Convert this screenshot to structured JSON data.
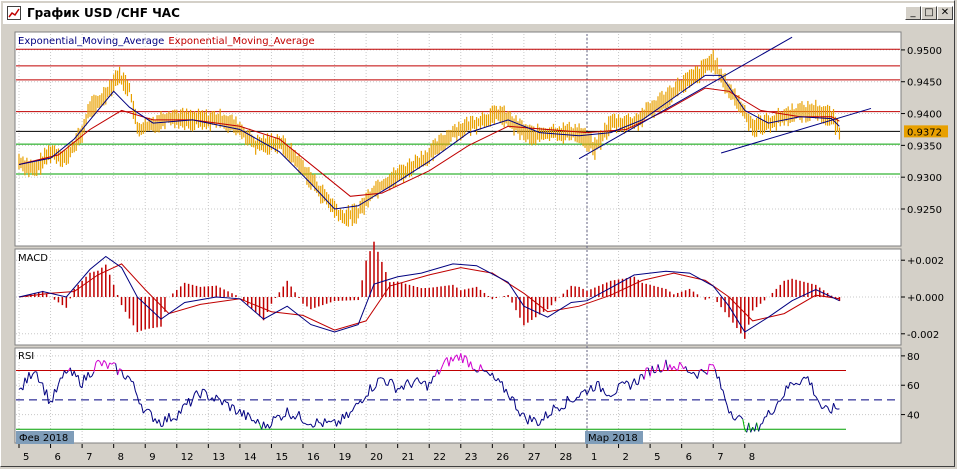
{
  "window": {
    "title": "График USD /CHF  ЧАС",
    "buttons": [
      {
        "name": "minimize",
        "glyph": "_"
      },
      {
        "name": "maximize",
        "glyph": "□"
      },
      {
        "name": "close",
        "glyph": "✕"
      }
    ]
  },
  "chart_data": [
    {
      "type": "line",
      "title": "Exponential_Moving_Average Exponential_Moving_Average",
      "series_labels": [
        "Exponential_Moving_Average",
        "Exponential_Moving_Average"
      ],
      "series_colors": {
        "price": "#e8a000",
        "ema_fast": "#000080",
        "ema_slow": "#c00000"
      },
      "ylim": [
        0.9195,
        0.9525
      ],
      "yticks": [
        "0.9500",
        "0.9450",
        "0.9400",
        "0.9350",
        "0.9300",
        "0.9250"
      ],
      "yticks_values": [
        0.95,
        0.945,
        0.94,
        0.935,
        0.93,
        0.925
      ],
      "current_price": "0.9372",
      "horizontal_levels": [
        {
          "value": 0.9501,
          "color": "#c00000"
        },
        {
          "value": 0.9475,
          "color": "#c00000"
        },
        {
          "value": 0.9453,
          "color": "#c00000"
        },
        {
          "value": 0.9403,
          "color": "#c00000"
        },
        {
          "value": 0.9372,
          "color": "#000000"
        },
        {
          "value": 0.9352,
          "color": "#00a000"
        },
        {
          "value": 0.9305,
          "color": "#00a000"
        }
      ],
      "price_points": [
        [
          0,
          0.9325
        ],
        [
          4,
          0.931
        ],
        [
          8,
          0.934
        ],
        [
          12,
          0.933
        ],
        [
          16,
          0.937
        ],
        [
          18,
          0.941
        ],
        [
          20,
          0.9415
        ],
        [
          23,
          0.944
        ],
        [
          25,
          0.946
        ],
        [
          28,
          0.944
        ],
        [
          30,
          0.9375
        ],
        [
          33,
          0.938
        ],
        [
          38,
          0.9395
        ],
        [
          44,
          0.939
        ],
        [
          52,
          0.939
        ],
        [
          56,
          0.9375
        ],
        [
          60,
          0.935
        ],
        [
          66,
          0.9355
        ],
        [
          70,
          0.933
        ],
        [
          76,
          0.928
        ],
        [
          82,
          0.9235
        ],
        [
          86,
          0.9245
        ],
        [
          90,
          0.928
        ],
        [
          94,
          0.9295
        ],
        [
          98,
          0.931
        ],
        [
          104,
          0.9335
        ],
        [
          110,
          0.937
        ],
        [
          116,
          0.9385
        ],
        [
          122,
          0.94
        ],
        [
          126,
          0.938
        ],
        [
          130,
          0.9365
        ],
        [
          136,
          0.937
        ],
        [
          142,
          0.937
        ],
        [
          146,
          0.9345
        ],
        [
          150,
          0.9385
        ],
        [
          156,
          0.9385
        ],
        [
          160,
          0.9405
        ],
        [
          164,
          0.9425
        ],
        [
          168,
          0.9445
        ],
        [
          172,
          0.946
        ],
        [
          176,
          0.9485
        ],
        [
          178,
          0.9455
        ],
        [
          182,
          0.942
        ],
        [
          186,
          0.938
        ],
        [
          190,
          0.9385
        ],
        [
          196,
          0.94
        ],
        [
          202,
          0.9405
        ],
        [
          206,
          0.9395
        ],
        [
          208,
          0.9372
        ]
      ],
      "ema_fast_points": [
        [
          0,
          0.932
        ],
        [
          8,
          0.933
        ],
        [
          14,
          0.936
        ],
        [
          20,
          0.9405
        ],
        [
          24,
          0.9435
        ],
        [
          28,
          0.941
        ],
        [
          34,
          0.9385
        ],
        [
          44,
          0.939
        ],
        [
          56,
          0.9375
        ],
        [
          66,
          0.934
        ],
        [
          74,
          0.929
        ],
        [
          80,
          0.925
        ],
        [
          86,
          0.9255
        ],
        [
          94,
          0.9285
        ],
        [
          104,
          0.9325
        ],
        [
          114,
          0.937
        ],
        [
          124,
          0.939
        ],
        [
          132,
          0.937
        ],
        [
          142,
          0.9365
        ],
        [
          150,
          0.937
        ],
        [
          158,
          0.939
        ],
        [
          166,
          0.9425
        ],
        [
          174,
          0.946
        ],
        [
          178,
          0.946
        ],
        [
          184,
          0.9405
        ],
        [
          190,
          0.9385
        ],
        [
          198,
          0.9395
        ],
        [
          206,
          0.9392
        ],
        [
          208,
          0.938
        ]
      ],
      "ema_slow_points": [
        [
          0,
          0.932
        ],
        [
          10,
          0.9335
        ],
        [
          18,
          0.9375
        ],
        [
          26,
          0.9405
        ],
        [
          34,
          0.939
        ],
        [
          44,
          0.939
        ],
        [
          56,
          0.938
        ],
        [
          66,
          0.936
        ],
        [
          76,
          0.931
        ],
        [
          84,
          0.927
        ],
        [
          92,
          0.9275
        ],
        [
          104,
          0.931
        ],
        [
          114,
          0.935
        ],
        [
          124,
          0.938
        ],
        [
          134,
          0.9375
        ],
        [
          144,
          0.937
        ],
        [
          154,
          0.9375
        ],
        [
          164,
          0.9405
        ],
        [
          174,
          0.944
        ],
        [
          180,
          0.9435
        ],
        [
          188,
          0.9405
        ],
        [
          198,
          0.9395
        ],
        [
          206,
          0.9395
        ],
        [
          208,
          0.9388
        ]
      ],
      "trend_lines": [
        {
          "from": [
            142,
            0.9329
          ],
          "to": [
            196,
            0.952
          ]
        },
        {
          "from": [
            178,
            0.9338
          ],
          "to": [
            216,
            0.9408
          ]
        }
      ]
    },
    {
      "type": "line",
      "title": "MACD",
      "ylim": [
        -0.0025,
        0.0025
      ],
      "yticks": [
        "+0.002",
        "+0.000",
        "-0.002"
      ],
      "yticks_values": [
        0.002,
        0.0,
        -0.002
      ],
      "series_colors": {
        "histogram": "#c00000",
        "macd": "#000080",
        "signal": "#c00000"
      },
      "macd_points": [
        [
          0,
          0.0
        ],
        [
          6,
          0.0003
        ],
        [
          12,
          0.0
        ],
        [
          18,
          0.0015
        ],
        [
          22,
          0.0022
        ],
        [
          26,
          0.0016
        ],
        [
          30,
          0.0
        ],
        [
          36,
          -0.0012
        ],
        [
          42,
          -0.0003
        ],
        [
          50,
          0.0
        ],
        [
          56,
          -0.0001
        ],
        [
          62,
          -0.0012
        ],
        [
          68,
          -0.0005
        ],
        [
          74,
          -0.0015
        ],
        [
          80,
          -0.0019
        ],
        [
          86,
          -0.0015
        ],
        [
          90,
          0.0007
        ],
        [
          96,
          0.0011
        ],
        [
          102,
          0.0013
        ],
        [
          110,
          0.0018
        ],
        [
          116,
          0.0017
        ],
        [
          124,
          0.0008
        ],
        [
          128,
          -0.0005
        ],
        [
          134,
          -0.0011
        ],
        [
          140,
          -0.0003
        ],
        [
          144,
          -0.0002
        ],
        [
          150,
          0.0005
        ],
        [
          156,
          0.0012
        ],
        [
          164,
          0.0014
        ],
        [
          170,
          0.0013
        ],
        [
          176,
          0.0006
        ],
        [
          180,
          -0.0005
        ],
        [
          184,
          -0.0019
        ],
        [
          190,
          -0.0011
        ],
        [
          196,
          -0.0002
        ],
        [
          202,
          0.0004
        ],
        [
          208,
          -0.0002
        ]
      ],
      "signal_points": [
        [
          0,
          0.0
        ],
        [
          8,
          0.0002
        ],
        [
          14,
          0.0003
        ],
        [
          20,
          0.0012
        ],
        [
          26,
          0.0018
        ],
        [
          32,
          0.0004
        ],
        [
          38,
          -0.0009
        ],
        [
          46,
          -0.0004
        ],
        [
          56,
          -0.0001
        ],
        [
          64,
          -0.0008
        ],
        [
          72,
          -0.001
        ],
        [
          80,
          -0.0018
        ],
        [
          88,
          -0.0013
        ],
        [
          94,
          0.0006
        ],
        [
          104,
          0.0012
        ],
        [
          112,
          0.0016
        ],
        [
          120,
          0.0013
        ],
        [
          128,
          0.0002
        ],
        [
          134,
          -0.0008
        ],
        [
          142,
          -0.0005
        ],
        [
          150,
          0.0001
        ],
        [
          158,
          0.0009
        ],
        [
          166,
          0.0013
        ],
        [
          174,
          0.0009
        ],
        [
          180,
          0.0
        ],
        [
          186,
          -0.0013
        ],
        [
          194,
          -0.0009
        ],
        [
          202,
          0.0001
        ],
        [
          208,
          -0.0001
        ]
      ]
    },
    {
      "type": "line",
      "title": "RSI",
      "ylim": [
        22,
        84
      ],
      "yticks": [
        "80",
        "60",
        "40"
      ],
      "yticks_values": [
        80,
        60,
        40
      ],
      "levels": [
        {
          "value": 70,
          "color": "#c00000"
        },
        {
          "value": 50,
          "color": "#000080",
          "dashed": true
        },
        {
          "value": 30,
          "color": "#00a000"
        }
      ],
      "rsi_points": [
        [
          0,
          55
        ],
        [
          4,
          72
        ],
        [
          8,
          48
        ],
        [
          12,
          70
        ],
        [
          16,
          62
        ],
        [
          20,
          75
        ],
        [
          24,
          72
        ],
        [
          28,
          65
        ],
        [
          32,
          42
        ],
        [
          36,
          35
        ],
        [
          40,
          40
        ],
        [
          46,
          55
        ],
        [
          52,
          48
        ],
        [
          58,
          38
        ],
        [
          62,
          32
        ],
        [
          68,
          42
        ],
        [
          74,
          35
        ],
        [
          80,
          33
        ],
        [
          84,
          40
        ],
        [
          88,
          55
        ],
        [
          92,
          65
        ],
        [
          96,
          58
        ],
        [
          100,
          62
        ],
        [
          104,
          60
        ],
        [
          108,
          75
        ],
        [
          112,
          80
        ],
        [
          116,
          72
        ],
        [
          120,
          65
        ],
        [
          124,
          55
        ],
        [
          128,
          38
        ],
        [
          132,
          35
        ],
        [
          136,
          45
        ],
        [
          140,
          50
        ],
        [
          146,
          60
        ],
        [
          150,
          55
        ],
        [
          156,
          62
        ],
        [
          160,
          70
        ],
        [
          164,
          74
        ],
        [
          168,
          72
        ],
        [
          172,
          68
        ],
        [
          176,
          73
        ],
        [
          180,
          44
        ],
        [
          184,
          33
        ],
        [
          186,
          28
        ],
        [
          190,
          40
        ],
        [
          196,
          62
        ],
        [
          200,
          65
        ],
        [
          204,
          42
        ],
        [
          208,
          45
        ]
      ]
    }
  ],
  "x_axis": {
    "labels": [
      "5",
      "6",
      "7",
      "8",
      "9",
      "12",
      "13",
      "14",
      "15",
      "16",
      "19",
      "20",
      "21",
      "22",
      "23",
      "26",
      "27",
      "28",
      "1",
      "2",
      "5",
      "6",
      "7",
      "8"
    ],
    "label_positions": [
      0,
      8,
      16,
      24,
      32,
      40,
      48,
      56,
      64,
      72,
      80,
      88,
      96,
      104,
      112,
      120,
      128,
      136,
      144,
      152,
      160,
      168,
      176,
      184
    ],
    "month_labels": [
      {
        "text": "Фев 2018",
        "pos": 0
      },
      {
        "text": "Мар 2018",
        "pos": 144
      }
    ]
  }
}
